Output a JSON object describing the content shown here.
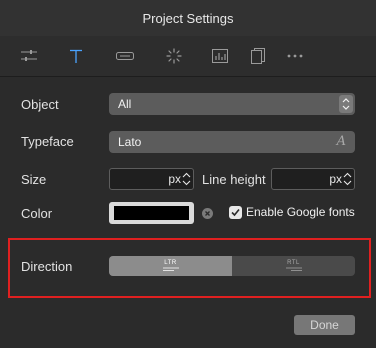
{
  "window": {
    "title": "Project Settings"
  },
  "toolbar": {
    "tools": [
      {
        "icon": "sliders-icon"
      },
      {
        "icon": "text-icon"
      },
      {
        "icon": "button-icon"
      },
      {
        "icon": "loader-icon"
      },
      {
        "icon": "chart-icon"
      },
      {
        "icon": "pages-icon"
      },
      {
        "icon": "more-icon"
      }
    ],
    "active_tool": "text-icon",
    "accent_color": "#4aa3ff"
  },
  "form": {
    "object": {
      "label": "Object",
      "value": "All"
    },
    "typeface": {
      "label": "Typeface",
      "value": "Lato"
    },
    "size": {
      "label": "Size",
      "value": "",
      "unit": "px"
    },
    "line_height": {
      "label": "Line height",
      "value": "",
      "unit": "px"
    },
    "color": {
      "label": "Color",
      "value": "#000000"
    },
    "google_fonts": {
      "label": "Enable Google fonts",
      "checked": true
    },
    "direction": {
      "label": "Direction",
      "options": [
        {
          "label": "LTR",
          "active": true
        },
        {
          "label": "RTL",
          "active": false
        }
      ]
    }
  },
  "footer": {
    "done_label": "Done"
  },
  "highlight_color": "#e02020"
}
